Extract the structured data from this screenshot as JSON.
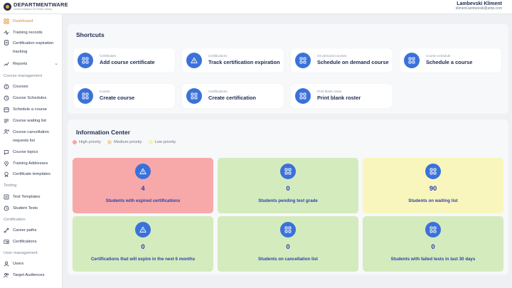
{
  "header": {
    "logo_name": "DEPARTMENTWARE",
    "logo_tagline": "Global Software For Public Safety",
    "user_name": "Lambevski Kliment",
    "user_email": "kliment.lambevski@amp.com"
  },
  "sidebar": {
    "items": [
      {
        "label": "Dashboard",
        "icon": "grid-icon",
        "active": true
      },
      {
        "label": "Training records",
        "icon": "activity-icon"
      },
      {
        "label": "Certification expiration tracking",
        "icon": "document-icon"
      },
      {
        "label": "Reports",
        "icon": "chart-icon"
      }
    ],
    "sections": [
      {
        "title": "Course management",
        "items": [
          {
            "label": "Courses",
            "icon": "book-icon"
          },
          {
            "label": "Course Schedules",
            "icon": "clock-icon"
          },
          {
            "label": "Schedule a course",
            "icon": "calendar-icon"
          },
          {
            "label": "Course waiting list",
            "icon": "list-icon"
          },
          {
            "label": "Course cancellation requests list",
            "icon": "cancel-user-icon"
          },
          {
            "label": "Course topics",
            "icon": "chat-icon"
          },
          {
            "label": "Training Addresses",
            "icon": "location-icon"
          },
          {
            "label": "Certificate templates",
            "icon": "badge-icon"
          }
        ]
      },
      {
        "title": "Testing",
        "items": [
          {
            "label": "Test Templates",
            "icon": "template-icon"
          },
          {
            "label": "Student Tests",
            "icon": "clock-icon"
          }
        ]
      },
      {
        "title": "Certification",
        "items": [
          {
            "label": "Career paths",
            "icon": "path-icon"
          },
          {
            "label": "Certifications",
            "icon": "certificate-icon"
          }
        ]
      },
      {
        "title": "User management",
        "items": [
          {
            "label": "Users",
            "icon": "user-icon"
          },
          {
            "label": "Target Audiences",
            "icon": "users-icon"
          }
        ]
      }
    ]
  },
  "shortcuts": {
    "title": "Shortcuts",
    "cards": [
      {
        "category": "Certificates",
        "title": "Add course certificate",
        "icon": "grid-icon"
      },
      {
        "category": "Certifications",
        "title": "Track certification expiration",
        "icon": "warning-icon"
      },
      {
        "category": "On demand courses",
        "title": "Schedule on demand course",
        "icon": "grid-icon"
      },
      {
        "category": "Course schedule",
        "title": "Schedule a course",
        "icon": "grid-icon"
      },
      {
        "category": "Course",
        "title": "Create course",
        "icon": "grid-icon"
      },
      {
        "category": "Certifications",
        "title": "Create certification",
        "icon": "grid-icon"
      },
      {
        "category": "Print blank roster",
        "title": "Print blank roster",
        "icon": "grid-icon"
      }
    ]
  },
  "info_center": {
    "title": "Information Center",
    "legend": [
      {
        "label": "High priority",
        "color": "#f5a3a3"
      },
      {
        "label": "Medium priority",
        "color": "#f3d7a3"
      },
      {
        "label": "Low priority",
        "color": "#f6f3a8"
      }
    ],
    "cards": [
      {
        "value": "4",
        "label": "Students with expired certifications",
        "icon": "warning-icon",
        "color": "#f7a9a9"
      },
      {
        "value": "0",
        "label": "Students pending test grade",
        "icon": "grid-icon",
        "color": "#d4ebbd"
      },
      {
        "value": "90",
        "label": "Students on waiting list",
        "icon": "grid-icon",
        "color": "#f9f6bd"
      },
      {
        "value": "0",
        "label": "Certifications that will expire in the next 6 months",
        "icon": "warning-icon",
        "color": "#d4ebbd"
      },
      {
        "value": "0",
        "label": "Students on cancellation list",
        "icon": "grid-icon",
        "color": "#d4ebbd"
      },
      {
        "value": "0",
        "label": "Students with failed tests in last 30 days",
        "icon": "grid-icon",
        "color": "#d4ebbd"
      }
    ]
  }
}
